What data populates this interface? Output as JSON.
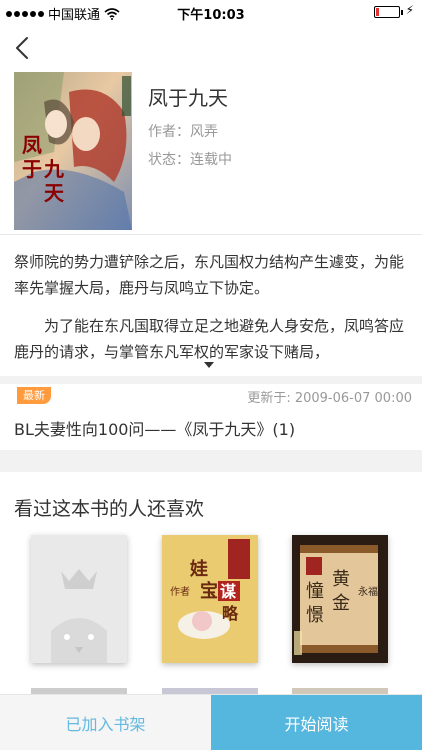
{
  "status_bar": {
    "carrier": "中国联通",
    "time": "下午10:03",
    "signal_bars_filled": 5,
    "battery_level": 0.15,
    "battery_color": "#e33333"
  },
  "book": {
    "title": "凤于九天",
    "author": "作者：风弄",
    "status": "状态：连载中",
    "cover_title_text": "凤于九天"
  },
  "description": {
    "paragraph1": "祭师院的势力遭铲除之后，东凡国权力结构产生遽变，为能率先掌握大局，鹿丹与凤鸣立下协定。",
    "paragraph2": "为了能在东凡国取得立足之地避免人身安危，凤鸣答应鹿丹的请求，与掌管东凡军权的军家设下赌局，"
  },
  "latest": {
    "badge": "最新",
    "update_time": "更新于: 2009-06-07 00:00",
    "chapter": "BL夫妻性向100问——《凤于九天》(1)"
  },
  "recommend": {
    "title": "看过这本书的人还喜欢",
    "books": [
      {
        "icon": "placeholder-cover-icon"
      },
      {
        "cover_text": "娃宝谋略",
        "side_text": "作者"
      },
      {
        "cover_text": "憧憬黄金",
        "side_text": "永福"
      }
    ]
  },
  "actions": {
    "shelf_label": "已加入书架",
    "read_label": "开始阅读",
    "shelf_color": "#63b9e0",
    "read_bg": "#56b7de"
  }
}
